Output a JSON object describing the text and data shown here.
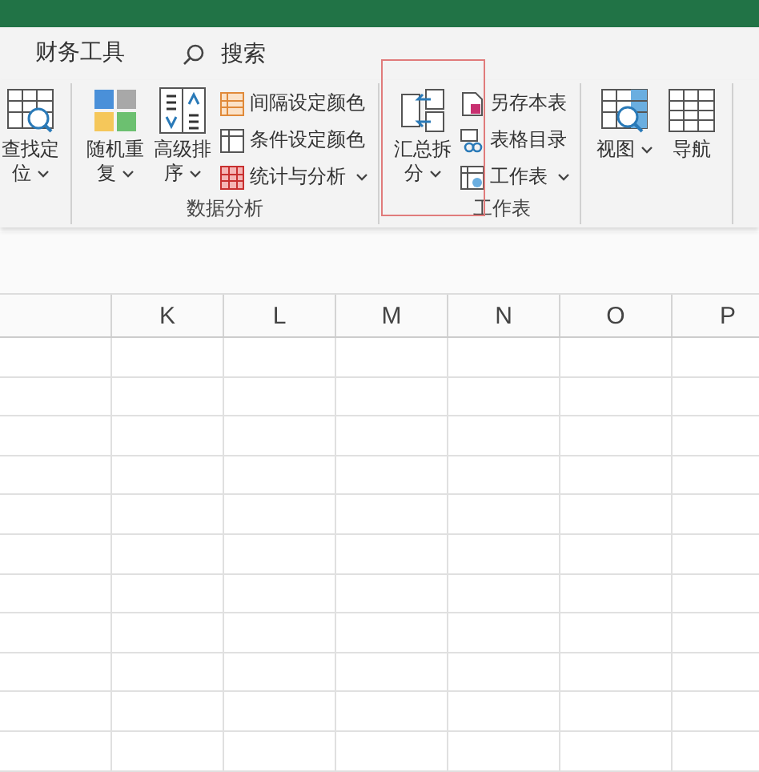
{
  "tabs": [
    {
      "label": "财务工具",
      "selected": false
    }
  ],
  "search": {
    "label": "搜索"
  },
  "groups": [
    {
      "items": [
        {
          "kind": "large",
          "label": "查找定位",
          "dropdown": true
        }
      ]
    },
    {
      "label": "数据分析",
      "items": [
        {
          "kind": "large",
          "label": "随机重复",
          "dropdown": true
        },
        {
          "kind": "large",
          "label": "高级排序",
          "dropdown": true
        },
        {
          "kind": "small",
          "label": "间隔设定颜色",
          "dropdown": false
        },
        {
          "kind": "small",
          "label": "条件设定颜色",
          "dropdown": false
        },
        {
          "kind": "small",
          "label": "统计与分析",
          "dropdown": true
        }
      ]
    },
    {
      "label": "工作表",
      "items": [
        {
          "kind": "large",
          "label": "汇总拆分",
          "dropdown": true
        },
        {
          "kind": "small",
          "label": "另存本表",
          "dropdown": false
        },
        {
          "kind": "small",
          "label": "表格目录",
          "dropdown": false
        },
        {
          "kind": "small",
          "label": "工作表",
          "dropdown": true
        }
      ]
    },
    {
      "items": [
        {
          "kind": "large",
          "label": "视图",
          "dropdown": true
        },
        {
          "kind": "large",
          "label": "导航",
          "dropdown": false
        }
      ]
    }
  ],
  "annotation": {
    "kind": "frame"
  },
  "columns": [
    "",
    "K",
    "L",
    "M",
    "N",
    "O",
    "P"
  ]
}
